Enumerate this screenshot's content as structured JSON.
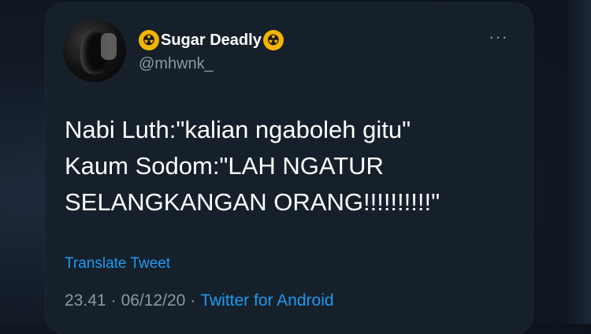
{
  "tweet": {
    "display_name": "Sugar Deadly",
    "handle": "@mhwnk_",
    "name_emoji": "☢",
    "menu_icon": "···",
    "lines": [
      "Nabi Luth:\"kalian ngaboleh gitu\"",
      "Kaum Sodom:\"LAH NGATUR",
      "SELANGKANGAN ORANG!!!!!!!!!!\""
    ],
    "translate_label": "Translate Tweet",
    "time": "23.41",
    "separator": "·",
    "date": "06/12/20",
    "source": "Twitter for Android"
  },
  "colors": {
    "background": "#15202b",
    "accent": "#1d9bf0",
    "secondary_text": "#8b98a5"
  }
}
